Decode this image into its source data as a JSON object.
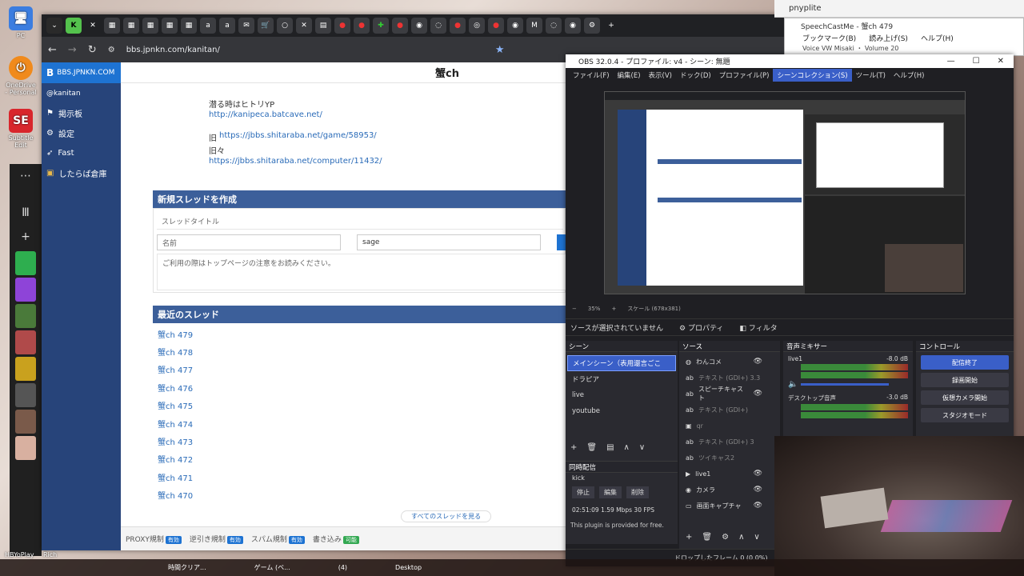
{
  "desktop": {
    "icons": [
      {
        "label": "PC"
      },
      {
        "label": "OneDrive\n- Personal"
      },
      {
        "label": "Subtitle Edit"
      },
      {
        "label": "HBYoPlay"
      },
      {
        "label": "Rich"
      }
    ]
  },
  "chrome": {
    "url": "bbs.jpnkn.com/kanitan/",
    "tabs": [
      "▦",
      "▦",
      "▦",
      "▦",
      "▦",
      "a",
      "a",
      "✉",
      "🛒",
      "○",
      "✕",
      "▤",
      "●",
      "●",
      "✚",
      "●",
      "◉",
      "◌",
      "●",
      "◎",
      "●",
      "◉",
      "M",
      "◌",
      "◉",
      "⚙"
    ]
  },
  "site": {
    "brand": "BBS.JPNKN.COM",
    "header_title": "蟹ch",
    "user": "@kanitan",
    "sidebar": [
      {
        "label": "掲示板",
        "icon": "flag-icon"
      },
      {
        "label": "設定",
        "icon": "gear-icon"
      },
      {
        "label": "Fast",
        "icon": "rocket-icon"
      },
      {
        "label": "したらば倉庫",
        "icon": "archive-icon"
      }
    ],
    "notes": {
      "line1": "潜る時はヒトリYP",
      "link1": "http://kanipeca.batcave.net/",
      "line2_prefix": "旧",
      "link2": "https://jbbs.shitaraba.net/game/58953/",
      "line3": "旧々",
      "link3": "https://jbbs.shitaraba.net/computer/11432/"
    },
    "new_thread": {
      "heading": "新規スレッドを作成",
      "title_placeholder": "スレッドタイトル",
      "name_placeholder": "名前",
      "mail_value": "sage",
      "body_placeholder": "ご利用の際はトップページの注意をお読みください。"
    },
    "recent": {
      "heading": "最近のスレッド",
      "threads": [
        "蟹ch 479",
        "蟹ch 478",
        "蟹ch 477",
        "蟹ch 476",
        "蟹ch 475",
        "蟹ch 474",
        "蟹ch 473",
        "蟹ch 472",
        "蟹ch 471",
        "蟹ch 470"
      ],
      "see_all": "すべてのスレッドを見る"
    },
    "footer": [
      {
        "label": "PROXY規制",
        "badge": "有効"
      },
      {
        "label": "逆引き規制",
        "badge": "有効"
      },
      {
        "label": "スパム規制",
        "badge": "有効"
      },
      {
        "label": "書き込み",
        "badge": "可能"
      }
    ]
  },
  "pnyp": {
    "title": "pnyplite"
  },
  "speech": {
    "title": "SpeechCastMe - 蟹ch 479",
    "menu": [
      "ブックマーク(B)",
      "読み上げ(S)",
      "ヘルプ(H)"
    ],
    "status": "Voice  VW Misaki ・ Volume 20"
  },
  "obs": {
    "title": "OBS 32.0.4 - プロファイル: v4 - シーン: 無題",
    "menu": [
      "ファイル(F)",
      "編集(E)",
      "表示(V)",
      "ドック(D)",
      "プロファイル(P)",
      "シーンコレクション(S)",
      "ツール(T)",
      "ヘルプ(H)"
    ],
    "active_menu": 5,
    "zoom": "35%",
    "scale": "スケール (678x381)",
    "no_source": "ソースが選択されていません",
    "properties": "プロパティ",
    "filters": "フィルタ",
    "scenes_title": "シーン",
    "scenes": [
      "メインシーン（表用還言ごこ",
      "ドラピア",
      "live",
      "youtube"
    ],
    "sources_title": "ソース",
    "sources": [
      {
        "label": "わんコメ",
        "icon": "globe-icon"
      },
      {
        "label": "テキスト (GDI+) 3.3",
        "icon": "text-icon"
      },
      {
        "label": "スピーチキャスト",
        "icon": "text-icon"
      },
      {
        "label": "テキスト (GDI+)",
        "icon": "text-icon"
      },
      {
        "label": "qr",
        "icon": "image-icon"
      },
      {
        "label": "テキスト (GDI+) 3",
        "icon": "text-icon"
      },
      {
        "label": "ツイキャス2",
        "icon": "text-icon"
      },
      {
        "label": "live1",
        "icon": "play-icon"
      },
      {
        "label": "カメラ",
        "icon": "camera-icon"
      },
      {
        "label": "画面キャプチャ",
        "icon": "monitor-icon"
      }
    ],
    "mixer_title": "音声ミキサー",
    "mixer": [
      {
        "name": "live1",
        "db": "-8.0 dB"
      },
      {
        "name": "デスクトップ音声",
        "db": "-3.0 dB"
      }
    ],
    "controls_title": "コントロール",
    "controls": [
      "配信終了",
      "録画開始",
      "仮想カメラ開始",
      "スタジオモード"
    ],
    "multi_title": "同時配信",
    "multi_target": "kick",
    "multi_buttons": [
      "停止",
      "編集",
      "削除"
    ],
    "multi_stats": "02:51:09  1.59 Mbps  30 FPS",
    "multi_note": "This plugin is provided for free.",
    "status": "ドロップしたフレーム 0 (0.0%)"
  },
  "taskbar": {
    "items": [
      "時間クリア...",
      "ゲーム (ベ...",
      "(4)",
      "Desktop"
    ]
  }
}
